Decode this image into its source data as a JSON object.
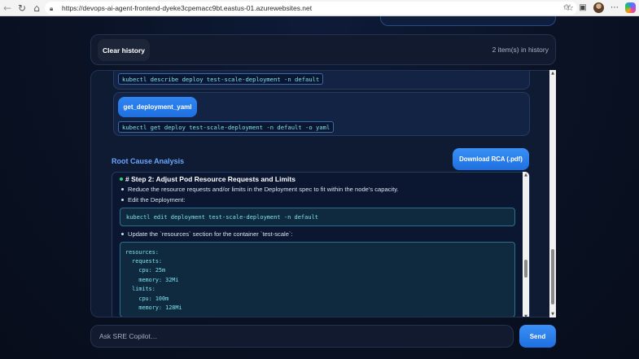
{
  "browser": {
    "url": "https://devops-ai-agent-frontend-dyeke3cpemacc9bt.eastus-01.azurewebsites.net"
  },
  "history": {
    "clear_label": "Clear history",
    "count_text": "2 item(s) in history"
  },
  "commands": [
    {
      "code": "kubectl describe deploy test-scale-deployment -n default"
    },
    {
      "tool": "get_deployment_yaml",
      "code": "kubectl get deploy test-scale-deployment -n default -o yaml"
    }
  ],
  "rca": {
    "title": "Root Cause Analysis",
    "download_label": "Download RCA (.pdf)",
    "step_title": "# Step 2: Adjust Pod Resource Requests and Limits",
    "bullets": [
      "Reduce the resource requests and/or limits in the Deployment spec to fit within the node's capacity.",
      "Edit the Deployment:",
      "Update the `resources` section for the container `test-scale`:"
    ],
    "edit_cmd": "kubectl edit deployment test-scale-deployment -n default",
    "yaml": [
      "resources:",
      "  requests:",
      "    cpu: 25m",
      "    memory: 32Mi",
      "  limits:",
      "    cpu: 100m",
      "    memory: 128Mi"
    ]
  },
  "input": {
    "placeholder": "Ask SRE Copilot…",
    "send_label": "Send"
  },
  "colors": {
    "accent": "#1f6fe0",
    "code_text": "#7fe0ef",
    "bullet_status": "#34d17a"
  }
}
